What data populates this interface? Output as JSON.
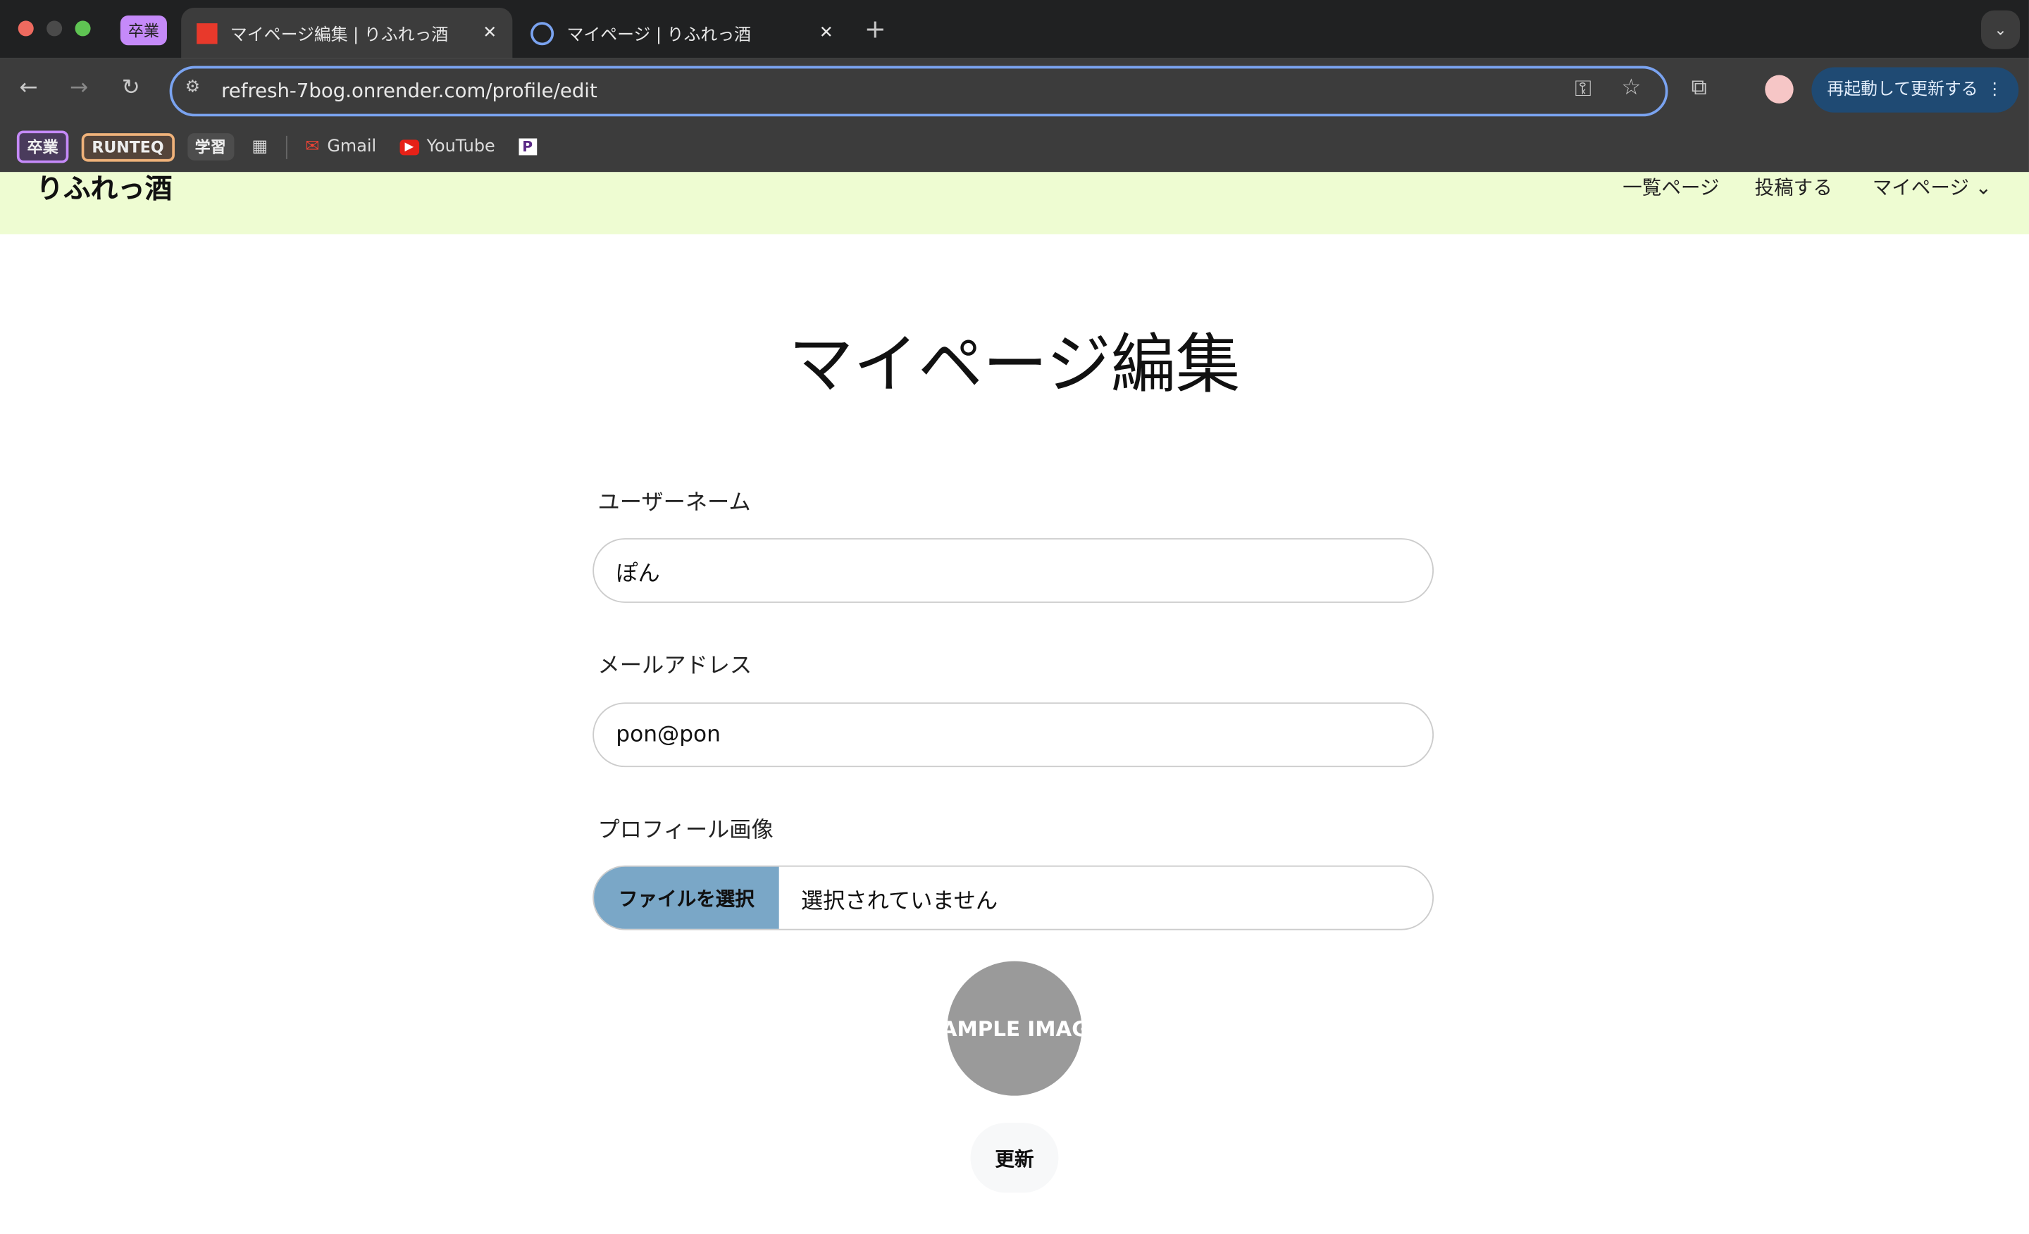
{
  "browser": {
    "tab_group": "卒業",
    "tabs": [
      {
        "title": "マイページ編集 | りふれっ酒",
        "active": true
      },
      {
        "title": "マイページ | りふれっ酒",
        "active": false
      }
    ],
    "url": "refresh-7bog.onrender.com/profile/edit",
    "update_button": "再起動して更新する",
    "bookmarks": [
      {
        "label": "卒業"
      },
      {
        "label": "RUNTEQ"
      },
      {
        "label": "学習"
      },
      {
        "label": "Gmail"
      },
      {
        "label": "YouTube"
      }
    ]
  },
  "site": {
    "logo": "りふれっ酒",
    "nav": [
      "一覧ページ",
      "投稿する",
      "マイページ"
    ]
  },
  "page": {
    "title": "マイページ編集",
    "username_label": "ユーザーネーム",
    "username_value": "ぽん",
    "email_label": "メールアドレス",
    "email_value": "pon@pon",
    "image_label": "プロフィール画像",
    "file_button": "ファイルを選択",
    "file_status": "選択されていません",
    "avatar_text": "SAMPLE IMAGE",
    "submit": "更新"
  },
  "colors": {
    "nav_bg": "#eefcd2",
    "file_button": "#7aa7c7",
    "accent": "#7aa3f0"
  }
}
